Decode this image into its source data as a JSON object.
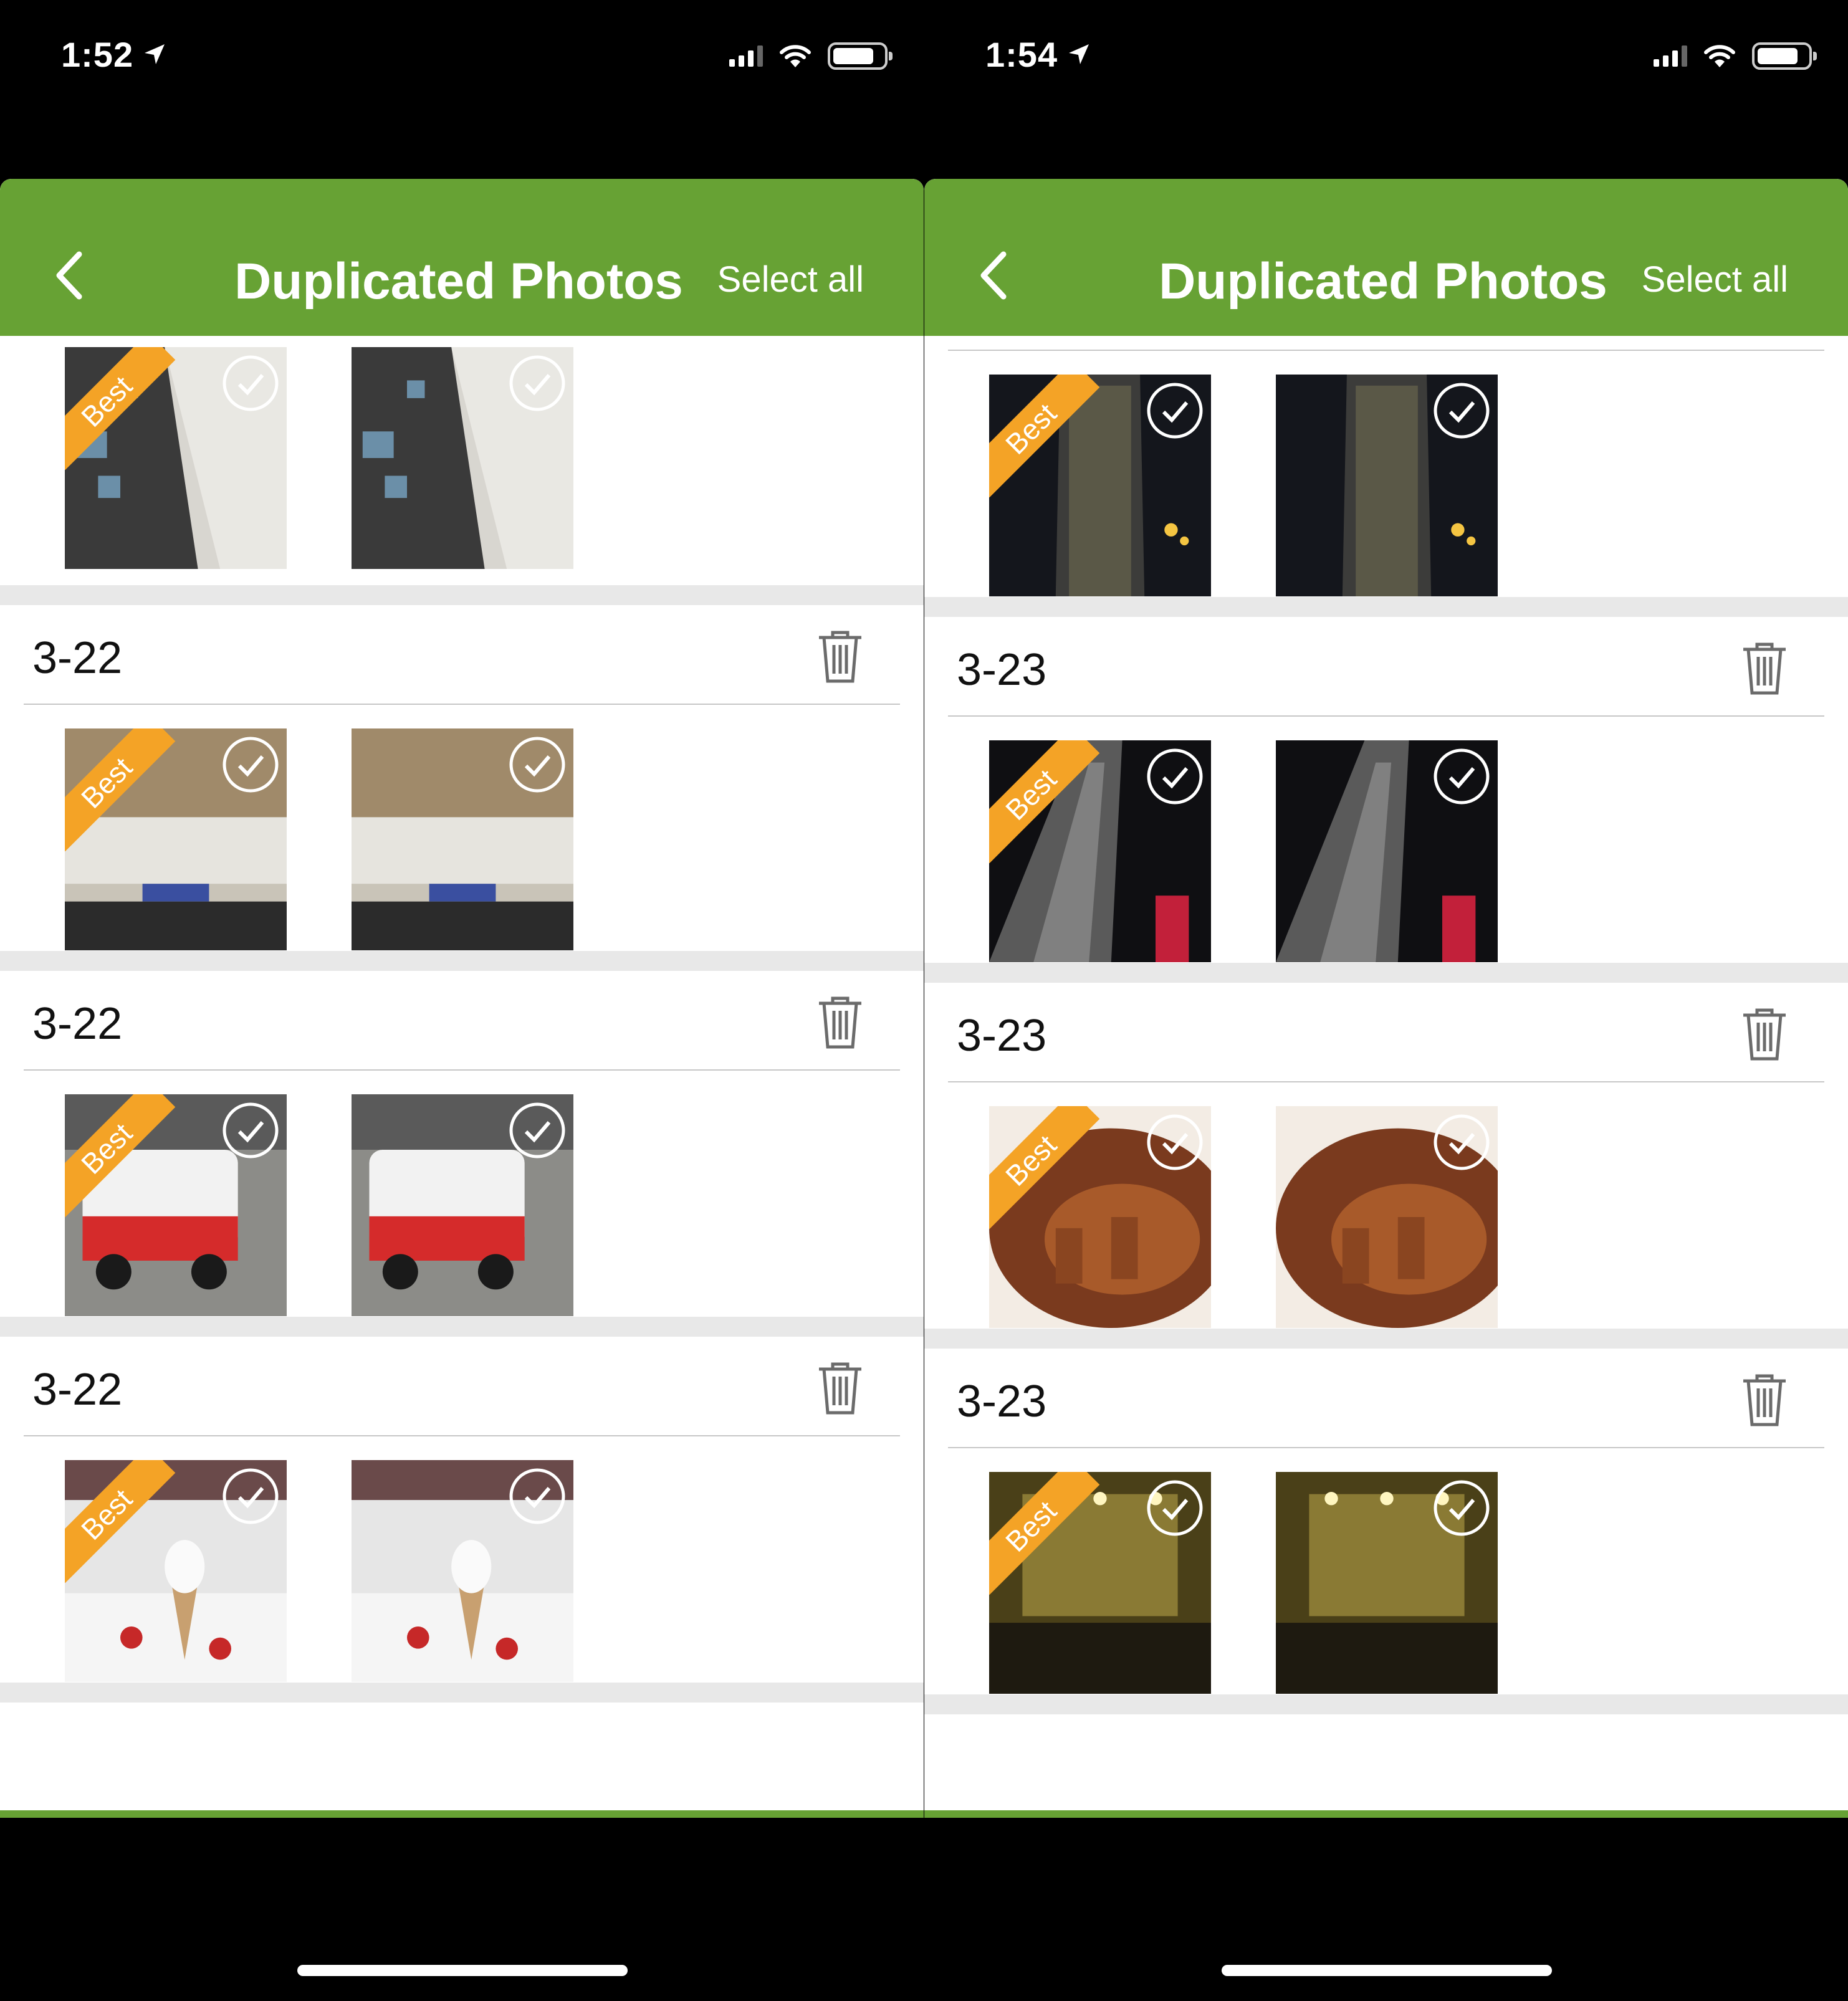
{
  "screens": [
    {
      "status_time": "1:52",
      "nav": {
        "title": "Duplicated Photos",
        "select_all": "Select all"
      },
      "groups": [
        {
          "date": "",
          "photos": [
            {
              "subject": "airplane-cabin",
              "best": true
            },
            {
              "subject": "airplane-cabin",
              "best": false
            }
          ]
        },
        {
          "date": "3-22",
          "photos": [
            {
              "subject": "airport-terminal",
              "best": true
            },
            {
              "subject": "airport-terminal",
              "best": false
            }
          ]
        },
        {
          "date": "3-22",
          "photos": [
            {
              "subject": "ice-cream-van",
              "best": true
            },
            {
              "subject": "ice-cream-van",
              "best": false
            }
          ]
        },
        {
          "date": "3-22",
          "photos": [
            {
              "subject": "ice-cream-cone",
              "best": true
            },
            {
              "subject": "ice-cream-cone",
              "best": false
            }
          ]
        }
      ]
    },
    {
      "status_time": "1:54",
      "nav": {
        "title": "Duplicated Photos",
        "select_all": "Select all"
      },
      "groups": [
        {
          "date": "",
          "photos": [
            {
              "subject": "night-skyscraper",
              "best": true
            },
            {
              "subject": "night-skyscraper",
              "best": false
            }
          ]
        },
        {
          "date": "3-23",
          "photos": [
            {
              "subject": "tower-looking-up",
              "best": true
            },
            {
              "subject": "tower-looking-up",
              "best": false
            }
          ]
        },
        {
          "date": "3-23",
          "photos": [
            {
              "subject": "roast-goose",
              "best": true
            },
            {
              "subject": "roast-goose",
              "best": false
            }
          ]
        },
        {
          "date": "3-23",
          "photos": [
            {
              "subject": "restaurant-facade",
              "best": true
            },
            {
              "subject": "restaurant-facade",
              "best": false
            }
          ]
        }
      ]
    }
  ],
  "best_label": "Best",
  "colors": {
    "nav_green": "#67a234",
    "best_orange": "#f4a326",
    "separator": "#e8e8e8"
  },
  "icons": [
    "back-chevron-icon",
    "trash-icon",
    "checkmark-circle-icon",
    "location-arrow-icon",
    "signal-icon",
    "wifi-icon",
    "battery-icon"
  ]
}
